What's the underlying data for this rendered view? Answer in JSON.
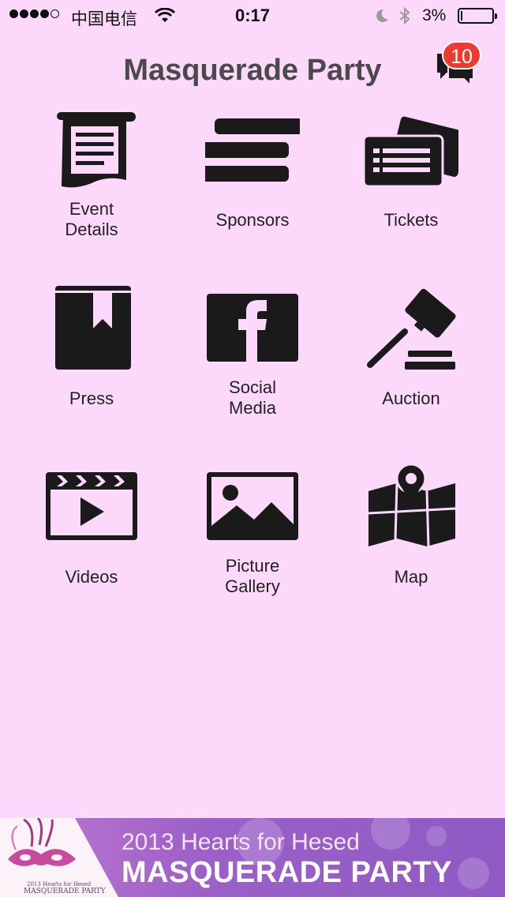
{
  "status_bar": {
    "carrier": "中国电信",
    "time": "0:17",
    "battery": "3%"
  },
  "header": {
    "title": "Masquerade Party",
    "notification_count": "10"
  },
  "menu": [
    {
      "label_line1": "Event",
      "label_line2": "Details",
      "icon": "event-details-icon"
    },
    {
      "label_line1": "Sponsors",
      "label_line2": "",
      "icon": "sponsors-icon"
    },
    {
      "label_line1": "Tickets",
      "label_line2": "",
      "icon": "tickets-icon"
    },
    {
      "label_line1": "Press",
      "label_line2": "",
      "icon": "press-icon"
    },
    {
      "label_line1": "Social",
      "label_line2": "Media",
      "icon": "facebook-icon"
    },
    {
      "label_line1": "Auction",
      "label_line2": "",
      "icon": "gavel-icon"
    },
    {
      "label_line1": "Videos",
      "label_line2": "",
      "icon": "video-clapper-icon"
    },
    {
      "label_line1": "Picture",
      "label_line2": "Gallery",
      "icon": "picture-icon"
    },
    {
      "label_line1": "Map",
      "label_line2": "",
      "icon": "map-icon"
    }
  ],
  "banner": {
    "line1": "2013 Hearts for Hesed",
    "line2": "MASQUERADE PARTY",
    "logo_line1": "2013 Hearts for Hesed",
    "logo_line2": "MASQUERADE PARTY"
  },
  "colors": {
    "background": "#fcd9fb",
    "icon": "#1a1a1a",
    "badge": "#ee3b30",
    "banner": "#9c60c8"
  }
}
